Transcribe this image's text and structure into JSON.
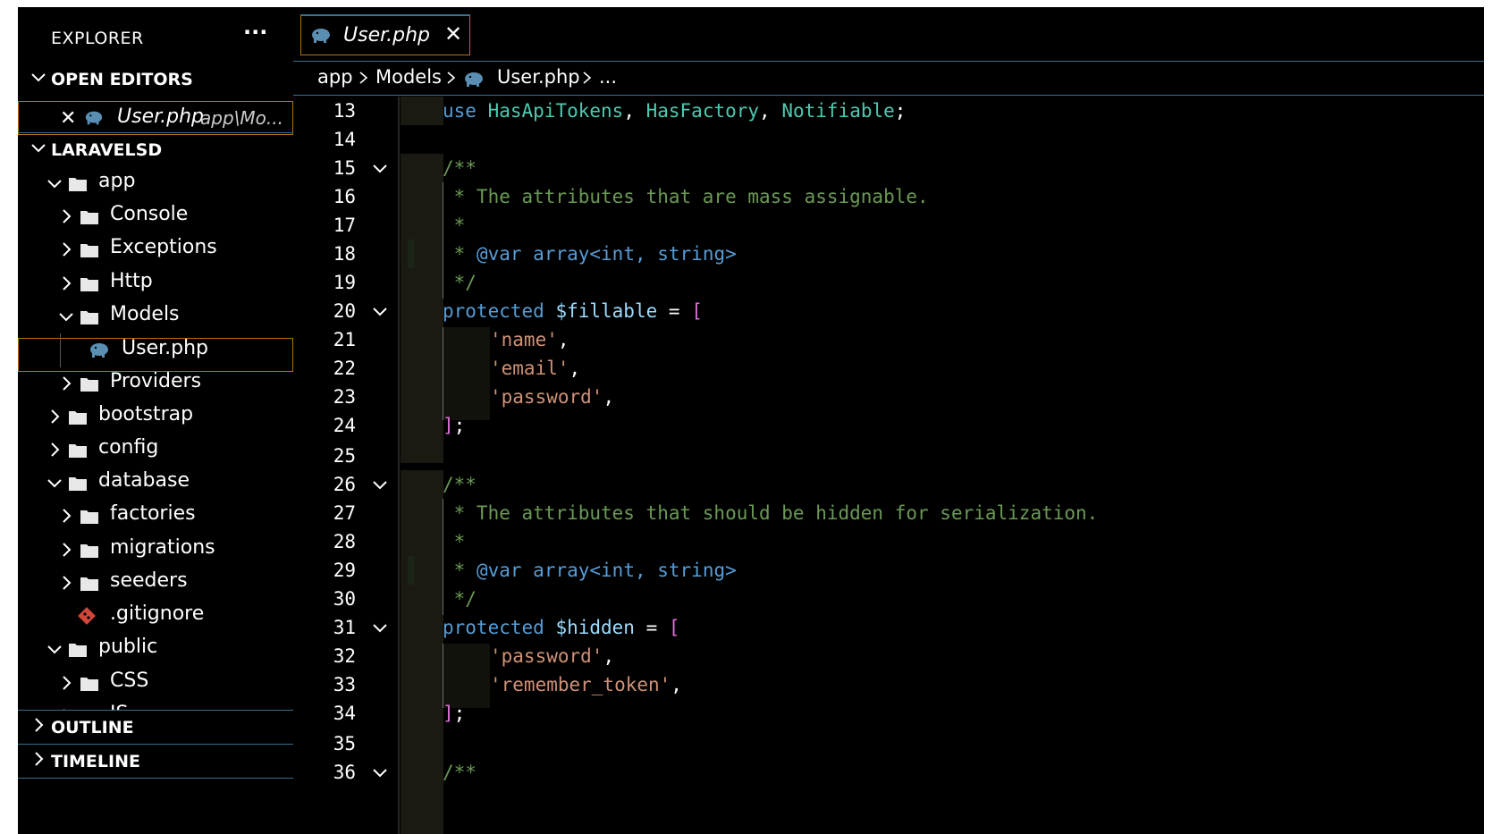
{
  "sidebar": {
    "title": "EXPLORER",
    "more": "···",
    "sections": {
      "open_editors": "OPEN EDITORS",
      "project": "LARAVELSD",
      "outline": "OUTLINE",
      "timeline": "TIMELINE"
    },
    "open_editor": {
      "close": "✕",
      "label": "User.php",
      "path": "app\\Mo..."
    },
    "tree": [
      {
        "label": "app",
        "type": "folder",
        "expanded": true
      },
      {
        "label": "Console",
        "type": "folder",
        "expanded": false
      },
      {
        "label": "Exceptions",
        "type": "folder",
        "expanded": false
      },
      {
        "label": "Http",
        "type": "folder",
        "expanded": false
      },
      {
        "label": "Models",
        "type": "folder",
        "expanded": true
      },
      {
        "label": "User.php",
        "type": "php-file"
      },
      {
        "label": "Providers",
        "type": "folder",
        "expanded": false
      },
      {
        "label": "bootstrap",
        "type": "folder",
        "expanded": false
      },
      {
        "label": "config",
        "type": "folder",
        "expanded": false
      },
      {
        "label": "database",
        "type": "folder",
        "expanded": true
      },
      {
        "label": "factories",
        "type": "folder",
        "expanded": false
      },
      {
        "label": "migrations",
        "type": "folder",
        "expanded": false
      },
      {
        "label": "seeders",
        "type": "folder",
        "expanded": false
      },
      {
        "label": ".gitignore",
        "type": "git-file"
      },
      {
        "label": "public",
        "type": "folder",
        "expanded": true
      },
      {
        "label": "CSS",
        "type": "folder",
        "expanded": false
      },
      {
        "label": "JS",
        "type": "folder",
        "expanded": false
      }
    ]
  },
  "editor": {
    "tab": {
      "label": "User.php",
      "close": "✕"
    },
    "breadcrumb": [
      "app",
      "Models",
      "User.php",
      "..."
    ],
    "lines": [
      {
        "n": "13",
        "fold": false
      },
      {
        "n": "14",
        "fold": false
      },
      {
        "n": "15",
        "fold": true
      },
      {
        "n": "16",
        "fold": false
      },
      {
        "n": "17",
        "fold": false
      },
      {
        "n": "18",
        "fold": false
      },
      {
        "n": "19",
        "fold": false
      },
      {
        "n": "20",
        "fold": true
      },
      {
        "n": "21",
        "fold": false
      },
      {
        "n": "22",
        "fold": false
      },
      {
        "n": "23",
        "fold": false
      },
      {
        "n": "24",
        "fold": false
      },
      {
        "n": "25",
        "fold": false
      },
      {
        "n": "26",
        "fold": true
      },
      {
        "n": "27",
        "fold": false
      },
      {
        "n": "28",
        "fold": false
      },
      {
        "n": "29",
        "fold": false
      },
      {
        "n": "30",
        "fold": false
      },
      {
        "n": "31",
        "fold": true
      },
      {
        "n": "32",
        "fold": false
      },
      {
        "n": "33",
        "fold": false
      },
      {
        "n": "34",
        "fold": false
      },
      {
        "n": "35",
        "fold": false
      },
      {
        "n": "36",
        "fold": true
      }
    ],
    "code": {
      "l13_use": "use",
      "l13_t1": "HasApiTokens",
      "l13_t2": "HasFactory",
      "l13_t3": "Notifiable",
      "comment_open": "/**",
      "l16": " * The attributes that are mass assignable.",
      "star": " *",
      "star_prefix": " * ",
      "var_tag": "@var",
      "var_type": "array<int, string>",
      "comment_close": " */",
      "protected": "protected",
      "fillable": "$fillable",
      "hidden": "$hidden",
      "eq": " = ",
      "open_bracket": "[",
      "close_bracket": "]",
      "semicolon": ";",
      "s_name": "'name'",
      "s_email": "'email'",
      "s_password": "'password'",
      "s_remember": "'remember_token'",
      "comma": ",",
      "sep": ", ",
      "l27": " * The attributes that should be hidden for serialization."
    }
  },
  "colors": {
    "border_accent": "#3a6f8f",
    "active_outline": "#b5720e",
    "keyword": "#569cd6",
    "type": "#4ec9b0",
    "comment": "#6a9955",
    "string": "#ce9178",
    "variable": "#9cdcfe",
    "bracket": "#da70d6"
  }
}
